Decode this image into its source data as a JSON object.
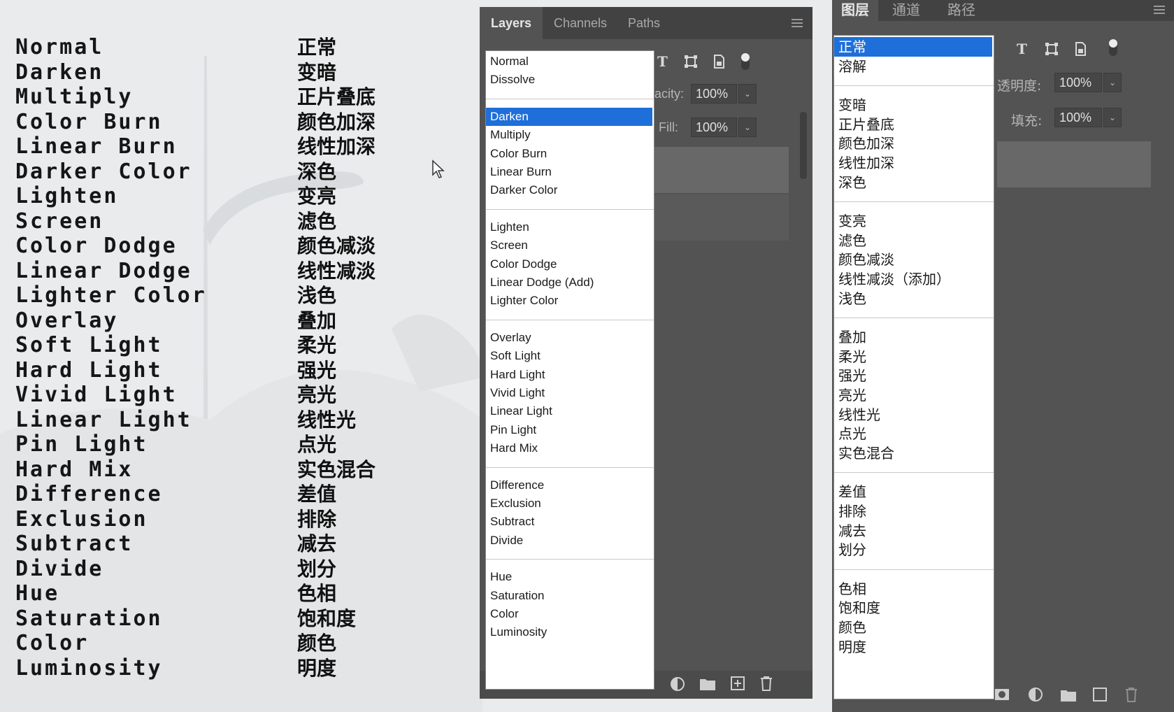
{
  "legend": {
    "rows": [
      {
        "en": "Normal",
        "zh": "正常"
      },
      {
        "en": "Darken",
        "zh": "变暗"
      },
      {
        "en": "Multiply",
        "zh": "正片叠底"
      },
      {
        "en": "Color Burn",
        "zh": "颜色加深"
      },
      {
        "en": "Linear Burn",
        "zh": "线性加深"
      },
      {
        "en": "Darker Color",
        "zh": "深色"
      },
      {
        "en": "Lighten",
        "zh": "变亮"
      },
      {
        "en": "Screen",
        "zh": "滤色"
      },
      {
        "en": "Color Dodge",
        "zh": "颜色减淡"
      },
      {
        "en": "Linear Dodge",
        "zh": "线性减淡"
      },
      {
        "en": "Lighter Color",
        "zh": "浅色"
      },
      {
        "en": "Overlay",
        "zh": "叠加"
      },
      {
        "en": "Soft Light",
        "zh": "柔光"
      },
      {
        "en": "Hard Light",
        "zh": "强光"
      },
      {
        "en": "Vivid Light",
        "zh": "亮光"
      },
      {
        "en": "Linear Light",
        "zh": "线性光"
      },
      {
        "en": "Pin Light",
        "zh": "点光"
      },
      {
        "en": "Hard Mix",
        "zh": "实色混合"
      },
      {
        "en": "Difference",
        "zh": "差值"
      },
      {
        "en": "Exclusion",
        "zh": "排除"
      },
      {
        "en": "Subtract",
        "zh": "减去"
      },
      {
        "en": "Divide",
        "zh": "划分"
      },
      {
        "en": "Hue",
        "zh": "色相"
      },
      {
        "en": "Saturation",
        "zh": "饱和度"
      },
      {
        "en": "Color",
        "zh": "颜色"
      },
      {
        "en": "Luminosity",
        "zh": "明度"
      }
    ]
  },
  "panel_en": {
    "tabs": [
      "Layers",
      "Channels",
      "Paths"
    ],
    "opacity_label": "acity:",
    "opacity_value": "100%",
    "fill_label": "Fill:",
    "fill_value": "100%",
    "selected_item": "Darken",
    "groups": [
      [
        "Normal",
        "Dissolve"
      ],
      [
        "Darken",
        "Multiply",
        "Color Burn",
        "Linear Burn",
        "Darker Color"
      ],
      [
        "Lighten",
        "Screen",
        "Color Dodge",
        "Linear Dodge (Add)",
        "Lighter Color"
      ],
      [
        "Overlay",
        "Soft Light",
        "Hard Light",
        "Vivid Light",
        "Linear Light",
        "Pin Light",
        "Hard Mix"
      ],
      [
        "Difference",
        "Exclusion",
        "Subtract",
        "Divide"
      ],
      [
        "Hue",
        "Saturation",
        "Color",
        "Luminosity"
      ]
    ]
  },
  "panel_zh": {
    "tabs": [
      "图层",
      "通道",
      "路径"
    ],
    "opacity_label": "透明度:",
    "opacity_value": "100%",
    "fill_label": "填充:",
    "fill_value": "100%",
    "selected_item": "正常",
    "groups": [
      [
        "正常",
        "溶解"
      ],
      [
        "变暗",
        "正片叠底",
        "颜色加深",
        "线性加深",
        "深色"
      ],
      [
        "变亮",
        "滤色",
        "颜色减淡",
        "线性减淡（添加）",
        "浅色"
      ],
      [
        "叠加",
        "柔光",
        "强光",
        "亮光",
        "线性光",
        "点光",
        "实色混合"
      ],
      [
        "差值",
        "排除",
        "减去",
        "划分"
      ],
      [
        "色相",
        "饱和度",
        "颜色",
        "明度"
      ]
    ]
  },
  "colors": {
    "selection": "#1e6fd9",
    "panel_bg": "#535353",
    "tab_bar": "#424242"
  }
}
